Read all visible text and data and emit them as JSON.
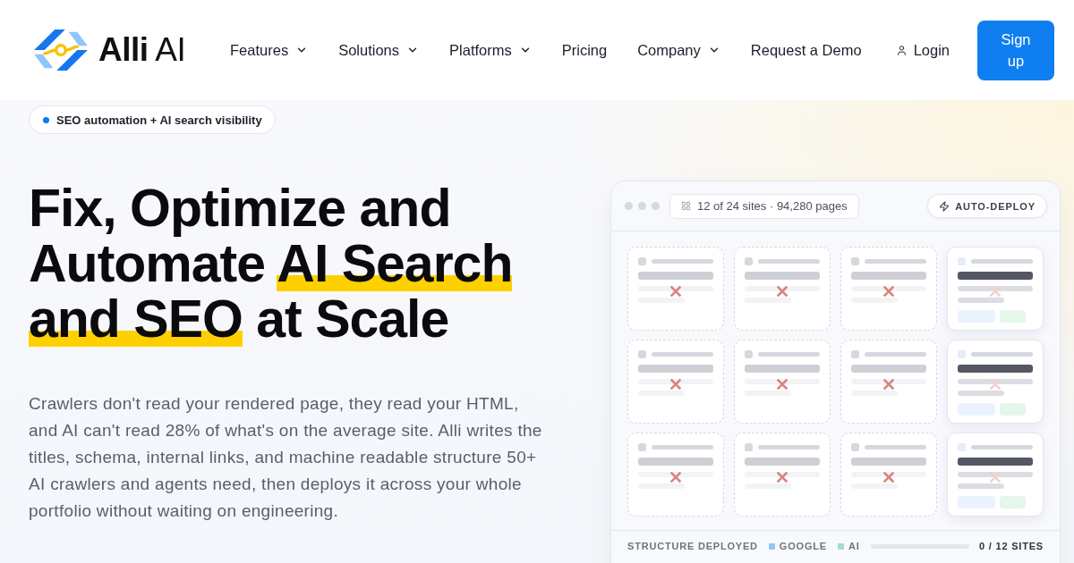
{
  "header": {
    "logo": {
      "wordmark": "**Alli** AI"
    },
    "nav": [
      {
        "label": "Features",
        "has_dropdown": true
      },
      {
        "label": "Solutions",
        "has_dropdown": true
      },
      {
        "label": "Platforms",
        "has_dropdown": true
      },
      {
        "label": "Pricing",
        "has_dropdown": false
      },
      {
        "label": "Company",
        "has_dropdown": true
      },
      {
        "label": "Request a Demo",
        "has_dropdown": false
      }
    ],
    "login": {
      "label": "Login"
    },
    "signup_button": {
      "label": "Sign up"
    }
  },
  "hero": {
    "badge": {
      "label": "SEO automation + AI search visibility"
    },
    "headline": [
      {
        "text": "Fix, Optimize and Automate ",
        "highlighted": false
      },
      {
        "text": "AI Search and SEO",
        "highlighted": true
      },
      {
        "text": " at Scale",
        "highlighted": false
      }
    ],
    "description": "Crawlers don't read your rendered page, they read your HTML, and AI can't read 28% of what's on the average site. Alli writes the titles, schema, internal links, and machine readable structure 50+ AI crawlers and agents need, then deploys it across your whole portfolio without waiting on engineering."
  },
  "dashboard": {
    "sites_summary": "12 of 24 sites · 94,280 pages",
    "auto_deploy": {
      "label": "AUTO-DEPLOY"
    },
    "sites": [
      {
        "deployed": false
      },
      {
        "deployed": false
      },
      {
        "deployed": false
      },
      {
        "deployed": true
      },
      {
        "deployed": false
      },
      {
        "deployed": false
      },
      {
        "deployed": false
      },
      {
        "deployed": true
      },
      {
        "deployed": false
      },
      {
        "deployed": false
      },
      {
        "deployed": false
      },
      {
        "deployed": true
      }
    ],
    "footer": {
      "label": "STRUCTURE DEPLOYED",
      "legend": [
        {
          "label": "GOOGLE",
          "color": "#93c4f7"
        },
        {
          "label": "AI",
          "color": "#9fdfc4"
        }
      ],
      "count": "0 / 12 SITES"
    }
  }
}
